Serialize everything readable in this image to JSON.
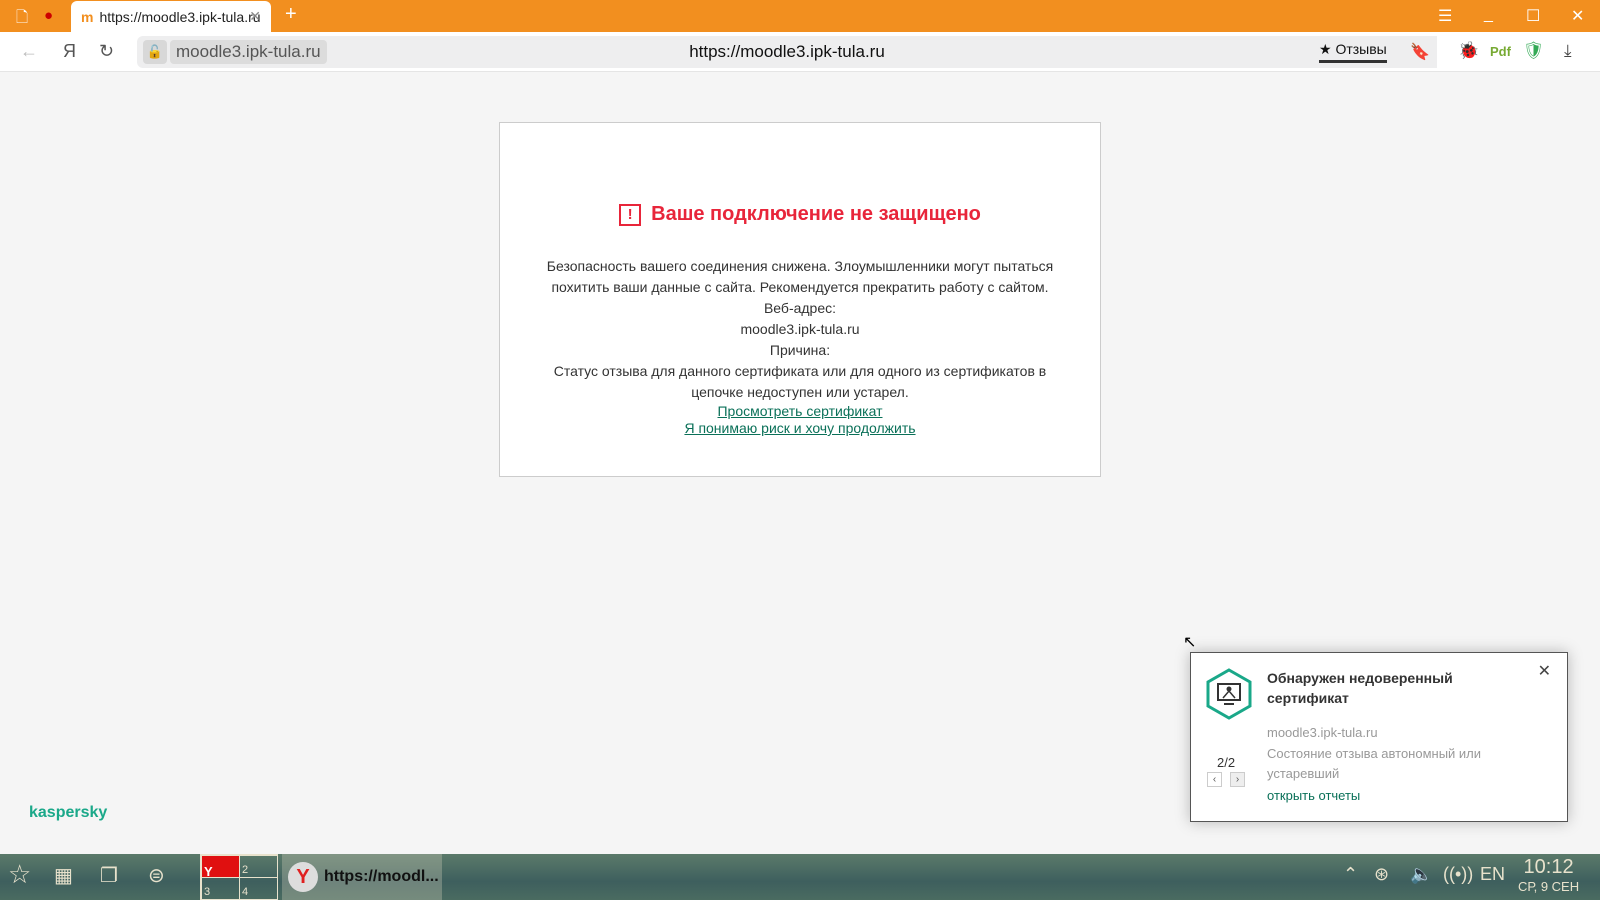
{
  "browser": {
    "tab": {
      "title": "https://moodle3.ipk-tula.ru",
      "favicon": "moodle-icon"
    },
    "new_tab": "+",
    "address": {
      "host": "moodle3.ipk-tula.ru",
      "url": "https://moodle3.ipk-tula.ru"
    },
    "reviews_label": "★ Отзывы",
    "yandex_label": "Я"
  },
  "page": {
    "title": "Ваше подключение не защищено",
    "lines": [
      "Безопасность вашего соединения снижена. Злоумышленники могут пытаться похитить ваши данные с сайта. Рекомендуется прекратить работу с сайтом.",
      "Веб-адрес:",
      "moodle3.ipk-tula.ru",
      "Причина:",
      "Статус отзыва для данного сертификата или для одного из сертификатов в цепочке недоступен или устарел."
    ],
    "links": [
      "Просмотреть сертификат",
      "Я понимаю риск и хочу продолжить"
    ],
    "brand": "kaspersky"
  },
  "notification": {
    "title": "Обнаружен недоверенный сертификат",
    "host": "moodle3.ipk-tula.ru",
    "message": "Состояние отзыва автономный или устаревший",
    "link": "открыть отчеты",
    "pager": "2/2"
  },
  "taskbar": {
    "desktops": [
      "2",
      "3",
      "4"
    ],
    "task_title": "https://moodl...",
    "lang": "EN",
    "time": "10:12",
    "date": "СР, 9 СЕН"
  },
  "colors": {
    "accent": "#f28f1f",
    "error": "#e8253a",
    "link": "#0a7058",
    "kaspersky": "#1aa889"
  }
}
